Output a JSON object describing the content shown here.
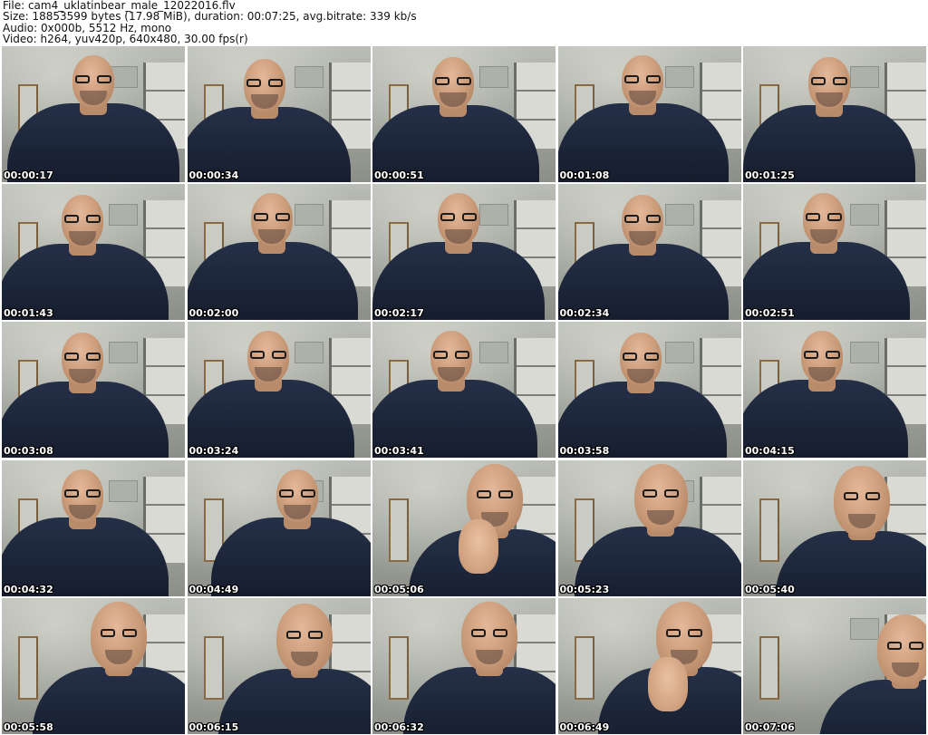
{
  "header": {
    "file_line": "File: cam4_uklatinbear_male_12022016.flv",
    "size_line": "Size: 18853599 bytes (17.98 MiB), duration: 00:07:25, avg.bitrate: 339 kb/s",
    "audio_line": "Audio: 0x000b, 5512 Hz, mono",
    "video_line": "Video: h264, yuv420p, 640x480, 30.00 fps(r)"
  },
  "thumbnails": [
    {
      "timestamp": "00:00:17"
    },
    {
      "timestamp": "00:00:34"
    },
    {
      "timestamp": "00:00:51"
    },
    {
      "timestamp": "00:01:08"
    },
    {
      "timestamp": "00:01:25"
    },
    {
      "timestamp": "00:01:43"
    },
    {
      "timestamp": "00:02:00"
    },
    {
      "timestamp": "00:02:17"
    },
    {
      "timestamp": "00:02:34"
    },
    {
      "timestamp": "00:02:51"
    },
    {
      "timestamp": "00:03:08"
    },
    {
      "timestamp": "00:03:24"
    },
    {
      "timestamp": "00:03:41"
    },
    {
      "timestamp": "00:03:58"
    },
    {
      "timestamp": "00:04:15"
    },
    {
      "timestamp": "00:04:32"
    },
    {
      "timestamp": "00:04:49"
    },
    {
      "timestamp": "00:05:06"
    },
    {
      "timestamp": "00:05:23"
    },
    {
      "timestamp": "00:05:40"
    },
    {
      "timestamp": "00:05:58"
    },
    {
      "timestamp": "00:06:15"
    },
    {
      "timestamp": "00:06:32"
    },
    {
      "timestamp": "00:06:49"
    },
    {
      "timestamp": "00:07:06"
    }
  ],
  "colors": {
    "background": "#ffffff",
    "text": "#111111",
    "robe": "#1b2437",
    "timestamp_text": "#ffffff"
  }
}
